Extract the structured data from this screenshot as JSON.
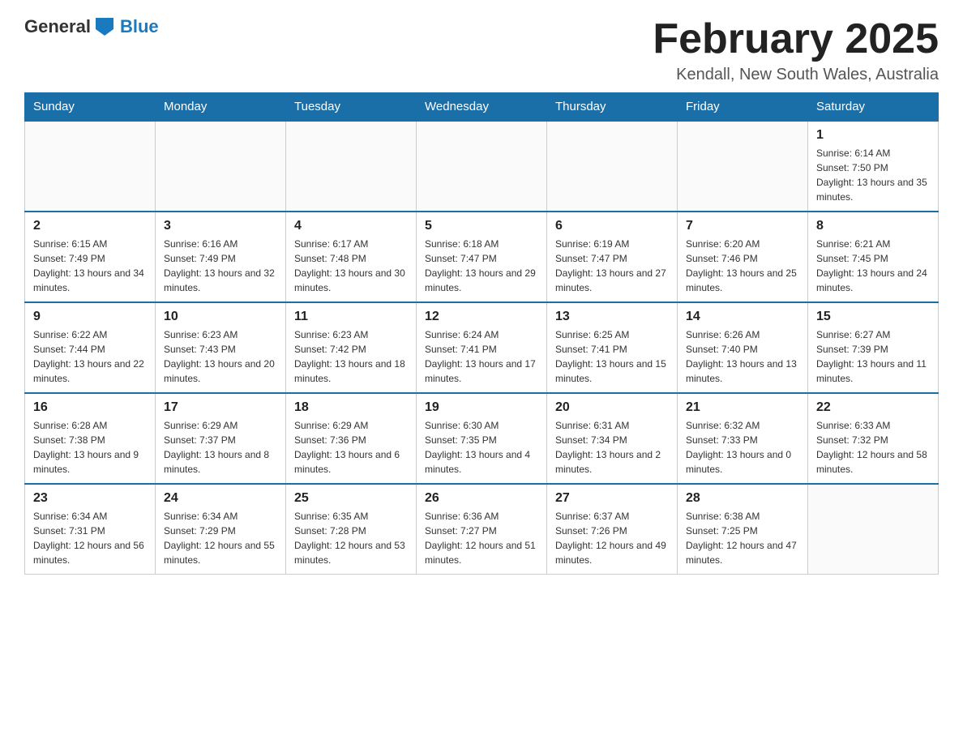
{
  "logo": {
    "text_general": "General",
    "text_blue": "Blue"
  },
  "title": {
    "month_year": "February 2025",
    "location": "Kendall, New South Wales, Australia"
  },
  "days_of_week": [
    "Sunday",
    "Monday",
    "Tuesday",
    "Wednesday",
    "Thursday",
    "Friday",
    "Saturday"
  ],
  "weeks": [
    {
      "days": [
        {
          "num": "",
          "info": ""
        },
        {
          "num": "",
          "info": ""
        },
        {
          "num": "",
          "info": ""
        },
        {
          "num": "",
          "info": ""
        },
        {
          "num": "",
          "info": ""
        },
        {
          "num": "",
          "info": ""
        },
        {
          "num": "1",
          "info": "Sunrise: 6:14 AM\nSunset: 7:50 PM\nDaylight: 13 hours and 35 minutes."
        }
      ]
    },
    {
      "days": [
        {
          "num": "2",
          "info": "Sunrise: 6:15 AM\nSunset: 7:49 PM\nDaylight: 13 hours and 34 minutes."
        },
        {
          "num": "3",
          "info": "Sunrise: 6:16 AM\nSunset: 7:49 PM\nDaylight: 13 hours and 32 minutes."
        },
        {
          "num": "4",
          "info": "Sunrise: 6:17 AM\nSunset: 7:48 PM\nDaylight: 13 hours and 30 minutes."
        },
        {
          "num": "5",
          "info": "Sunrise: 6:18 AM\nSunset: 7:47 PM\nDaylight: 13 hours and 29 minutes."
        },
        {
          "num": "6",
          "info": "Sunrise: 6:19 AM\nSunset: 7:47 PM\nDaylight: 13 hours and 27 minutes."
        },
        {
          "num": "7",
          "info": "Sunrise: 6:20 AM\nSunset: 7:46 PM\nDaylight: 13 hours and 25 minutes."
        },
        {
          "num": "8",
          "info": "Sunrise: 6:21 AM\nSunset: 7:45 PM\nDaylight: 13 hours and 24 minutes."
        }
      ]
    },
    {
      "days": [
        {
          "num": "9",
          "info": "Sunrise: 6:22 AM\nSunset: 7:44 PM\nDaylight: 13 hours and 22 minutes."
        },
        {
          "num": "10",
          "info": "Sunrise: 6:23 AM\nSunset: 7:43 PM\nDaylight: 13 hours and 20 minutes."
        },
        {
          "num": "11",
          "info": "Sunrise: 6:23 AM\nSunset: 7:42 PM\nDaylight: 13 hours and 18 minutes."
        },
        {
          "num": "12",
          "info": "Sunrise: 6:24 AM\nSunset: 7:41 PM\nDaylight: 13 hours and 17 minutes."
        },
        {
          "num": "13",
          "info": "Sunrise: 6:25 AM\nSunset: 7:41 PM\nDaylight: 13 hours and 15 minutes."
        },
        {
          "num": "14",
          "info": "Sunrise: 6:26 AM\nSunset: 7:40 PM\nDaylight: 13 hours and 13 minutes."
        },
        {
          "num": "15",
          "info": "Sunrise: 6:27 AM\nSunset: 7:39 PM\nDaylight: 13 hours and 11 minutes."
        }
      ]
    },
    {
      "days": [
        {
          "num": "16",
          "info": "Sunrise: 6:28 AM\nSunset: 7:38 PM\nDaylight: 13 hours and 9 minutes."
        },
        {
          "num": "17",
          "info": "Sunrise: 6:29 AM\nSunset: 7:37 PM\nDaylight: 13 hours and 8 minutes."
        },
        {
          "num": "18",
          "info": "Sunrise: 6:29 AM\nSunset: 7:36 PM\nDaylight: 13 hours and 6 minutes."
        },
        {
          "num": "19",
          "info": "Sunrise: 6:30 AM\nSunset: 7:35 PM\nDaylight: 13 hours and 4 minutes."
        },
        {
          "num": "20",
          "info": "Sunrise: 6:31 AM\nSunset: 7:34 PM\nDaylight: 13 hours and 2 minutes."
        },
        {
          "num": "21",
          "info": "Sunrise: 6:32 AM\nSunset: 7:33 PM\nDaylight: 13 hours and 0 minutes."
        },
        {
          "num": "22",
          "info": "Sunrise: 6:33 AM\nSunset: 7:32 PM\nDaylight: 12 hours and 58 minutes."
        }
      ]
    },
    {
      "days": [
        {
          "num": "23",
          "info": "Sunrise: 6:34 AM\nSunset: 7:31 PM\nDaylight: 12 hours and 56 minutes."
        },
        {
          "num": "24",
          "info": "Sunrise: 6:34 AM\nSunset: 7:29 PM\nDaylight: 12 hours and 55 minutes."
        },
        {
          "num": "25",
          "info": "Sunrise: 6:35 AM\nSunset: 7:28 PM\nDaylight: 12 hours and 53 minutes."
        },
        {
          "num": "26",
          "info": "Sunrise: 6:36 AM\nSunset: 7:27 PM\nDaylight: 12 hours and 51 minutes."
        },
        {
          "num": "27",
          "info": "Sunrise: 6:37 AM\nSunset: 7:26 PM\nDaylight: 12 hours and 49 minutes."
        },
        {
          "num": "28",
          "info": "Sunrise: 6:38 AM\nSunset: 7:25 PM\nDaylight: 12 hours and 47 minutes."
        },
        {
          "num": "",
          "info": ""
        }
      ]
    }
  ]
}
